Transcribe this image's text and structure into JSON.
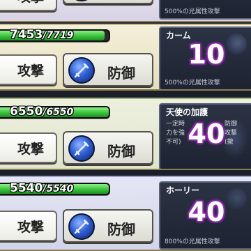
{
  "rows": [
    {
      "hp_current": "",
      "hp_max": "",
      "hp_fraction": 0,
      "attack_label": "攻撃",
      "defend_label": "防御",
      "skill": {
        "name": "",
        "cost": "",
        "desc": "500%の光属性攻撃",
        "desc_lines": []
      }
    },
    {
      "hp_current": "7453",
      "hp_max": "/7719",
      "hp_fraction": 0.965,
      "attack_label": "攻撃",
      "defend_label": "防御",
      "skill": {
        "name": "カーム",
        "cost": "10",
        "desc": "500%の光属性攻撃",
        "desc_lines": []
      }
    },
    {
      "hp_current": "6550",
      "hp_max": "/6550",
      "hp_fraction": 1.0,
      "attack_label": "攻撃",
      "defend_label": "防御",
      "skill": {
        "name": "天使の加護",
        "cost": "40",
        "desc": "",
        "desc_lines": [
          "一定時",
          "力を強",
          "不可)"
        ],
        "desc_right_lines": [
          "防御",
          "攻撃",
          "(撤"
        ]
      }
    },
    {
      "hp_current": "5540",
      "hp_max": "/5540",
      "hp_fraction": 1.0,
      "attack_label": "攻撃",
      "defend_label": "防御",
      "skill": {
        "name": "ホーリー",
        "cost": "40",
        "desc": "800%の光属性攻撃",
        "desc_lines": []
      }
    }
  ],
  "icons": {
    "defend_orb": "sword-shield-icon",
    "skill_bg_1": "moon-icon",
    "skill_bg_2": "feather-icon"
  },
  "colors": {
    "hp_green": "#39c23a",
    "cost_glow": "#c34bd1",
    "skill_panel": "#1d2332"
  }
}
